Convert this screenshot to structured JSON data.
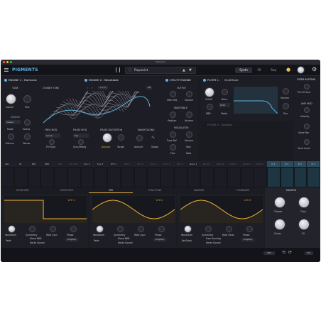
{
  "window_title": "Pigments",
  "app": {
    "brand": "PIGMENTS"
  },
  "topbar": {
    "preset": "Rayonist",
    "tabs": [
      {
        "label": "Synth"
      },
      {
        "label": "FX"
      },
      {
        "label": "Seq"
      }
    ]
  },
  "engine1": {
    "header": "ENGINE 1 : Harmonic",
    "tune": "TUNE",
    "chunky": "CHUNKY TONE",
    "coarse": "Coarse",
    "fine": "Fine",
    "unison": "UNISON",
    "mode_value": "Classic",
    "mode": "Mode",
    "voices": "Voices",
    "detune": "Detune",
    "stereo": "Stereo"
  },
  "engine2": {
    "header": "ENGINE 2 : Wavetable",
    "morph": "Morph",
    "zoom": "2D",
    "freq_mod": "FREQ MOD",
    "freq_value": "Linear",
    "fm_type": "FM Type",
    "phase_mod": "PHASE MOD",
    "phase_value": "Key",
    "sync_retrig": "Sync/Retrig",
    "phase_dist": "PHASE DISTORTION",
    "amount": "Amount",
    "target": "Target",
    "wavefolding": "WAVEFOLDING",
    "wf_amount": "Amount",
    "shape": "Shape"
  },
  "utility": {
    "header": "UTILITY ENGINE",
    "output": "OUTPUT",
    "filter_mix": "Filter Mix",
    "volume": "Volume",
    "wavetable": "WAVETABLE",
    "position": "Position",
    "wt_volume": "Volume",
    "modulator": "MODULATOR",
    "tune_ref": "Tune Ref",
    "mod_volume": "Volume",
    "fine": "Fine",
    "rate": "Rate",
    "size": "Size"
  },
  "filter1": {
    "header": "FILTER 1 :",
    "type": "MultiMode",
    "cutoff": "Cutoff",
    "reso": "Reso",
    "lp": "LP12",
    "mode": "Mode",
    "kbd": "KBD",
    "volume": "Volume",
    "pan": "Pan"
  },
  "filter2": {
    "header": "FILTER 2 : Surgeon"
  },
  "routing": {
    "header": "FILTER ROUTING",
    "value": "Pre-FX Sum",
    "amp_mod": "AMP MOD",
    "velocity": "Velocity",
    "voice_pan": "Voice Pan",
    "send_level": "Send Level"
  },
  "modtabs": [
    "Velo",
    "AT",
    "MW",
    "KBD",
    "Ext",
    "Env VCA",
    "Env 2",
    "Env 3",
    "LFO 1",
    "LFO 2",
    "LFO 3",
    "Func 1",
    "Func 2",
    "Func 3",
    "Rand 1",
    "Rand 2",
    "Rand 3",
    "Comb 1",
    "Comb 2",
    "Comb 3",
    "M 1",
    "M 2",
    "M 3",
    "M 4"
  ],
  "sections": [
    "KEYBOARD",
    "ENVELOPES",
    "LFO",
    "FUNCTIONS",
    "RANDOM",
    "COMBINATE"
  ],
  "lfos": [
    {
      "name": "LFO 1",
      "waveform": "Waveform",
      "symmetry": "Symmetry",
      "rate": "Rate Sync",
      "phase": "Phase",
      "fade": "Fade",
      "mono": "Mono KBD",
      "reset": "Reset Source",
      "poly": "Unipolar"
    },
    {
      "name": "LFO 2",
      "waveform": "Waveform",
      "symmetry": "Symmetry",
      "rate": "Rate Sync",
      "phase": "Phase",
      "fade": "Fade",
      "mono": "Mono KBD",
      "reset": "Reset Source",
      "poly": "Unipolar"
    },
    {
      "name": "LFO 3",
      "waveform": "Waveform",
      "symmetry": "Symmetry",
      "rate": "Rate Hertz",
      "phase": "Phase",
      "fade": "KeyTrack",
      "mono": "Free Running",
      "reset": "Reset Source",
      "poly": "Unipolar"
    }
  ],
  "macro": {
    "header": "MACROS",
    "m1": "Timbre",
    "m2": "Time",
    "m3": "Chaos",
    "m4": "FX"
  },
  "bottom": {
    "cpu": "CPU",
    "undo": "⟲",
    "redo": "⟳",
    "pct": "5%"
  },
  "colors": {
    "accent": "#5fb1df",
    "lfo": "#f0b53b",
    "wave": "#e8e8ee"
  }
}
